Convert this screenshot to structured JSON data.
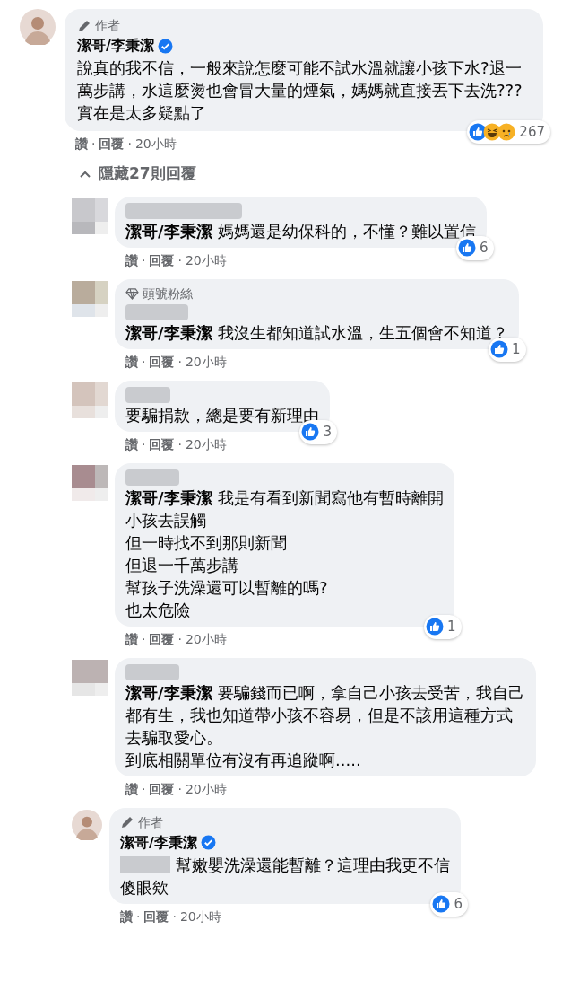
{
  "separator": "·",
  "comment": {
    "badge": {
      "kind": "author",
      "label": "作者"
    },
    "name": "潔哥/李秉潔",
    "verified": true,
    "text": "說真的我不信，一般來說怎麼可能不試水溫就讓小孩下水?退一萬步講，水這麼燙也會冒大量的煙氣，媽媽就直接丟下去洗???實在是太多疑點了",
    "reactions": [
      {
        "kind": "like"
      },
      {
        "kind": "haha"
      },
      {
        "kind": "sad"
      }
    ],
    "reaction_count": "267",
    "actions": {
      "like": "讚",
      "reply": "回覆",
      "time": "20小時"
    }
  },
  "toggle": {
    "label": "隱藏27則回覆",
    "expanded": true
  },
  "replies": [
    {
      "kind": "user",
      "mention": "潔哥/李秉潔",
      "lines": [
        "媽媽還是幼保科的，不懂？難以置信"
      ],
      "reactions": [
        {
          "kind": "like"
        }
      ],
      "reaction_count": "6",
      "actions": {
        "like": "讚",
        "reply": "回覆",
        "time": "20小時"
      }
    },
    {
      "kind": "user",
      "badge": {
        "kind": "fan",
        "label": "頭號粉絲"
      },
      "mention": "潔哥/李秉潔",
      "lines": [
        "我沒生都知道試水溫，生五個會不知道？"
      ],
      "reactions": [
        {
          "kind": "like"
        }
      ],
      "reaction_count": "1",
      "actions": {
        "like": "讚",
        "reply": "回覆",
        "time": "20小時"
      }
    },
    {
      "kind": "user",
      "lines": [
        "要騙捐款，總是要有新理由"
      ],
      "reactions": [
        {
          "kind": "like"
        }
      ],
      "reaction_count": "3",
      "actions": {
        "like": "讚",
        "reply": "回覆",
        "time": "20小時"
      }
    },
    {
      "kind": "user",
      "mention": "潔哥/李秉潔",
      "lines": [
        "我是有看到新聞寫他有暫時離開",
        "小孩去誤觸",
        "但一時找不到那則新聞",
        "但退一千萬步講",
        "幫孩子洗澡還可以暫離的嗎?",
        "也太危險"
      ],
      "reactions": [
        {
          "kind": "like"
        }
      ],
      "reaction_count": "1",
      "actions": {
        "like": "讚",
        "reply": "回覆",
        "time": "20小時"
      }
    },
    {
      "kind": "user",
      "mention": "潔哥/李秉潔",
      "lines": [
        "要騙錢而已啊，拿自己小孩去受苦，我自己都有生，我也知道帶小孩不容易，但是不該用這種方式去騙取愛心。",
        "到底相關單位有沒有再追蹤啊....."
      ],
      "actions": {
        "like": "讚",
        "reply": "回覆",
        "time": "20小時"
      }
    },
    {
      "kind": "author",
      "badge": {
        "kind": "author",
        "label": "作者"
      },
      "name": "潔哥/李秉潔",
      "verified": true,
      "lines": [
        "幫嫩嬰洗澡還能暫離？這理由我更不信",
        "傻眼欸"
      ],
      "reactions": [
        {
          "kind": "like"
        }
      ],
      "reaction_count": "6",
      "actions": {
        "like": "讚",
        "reply": "回覆",
        "time": "20小時"
      }
    }
  ]
}
